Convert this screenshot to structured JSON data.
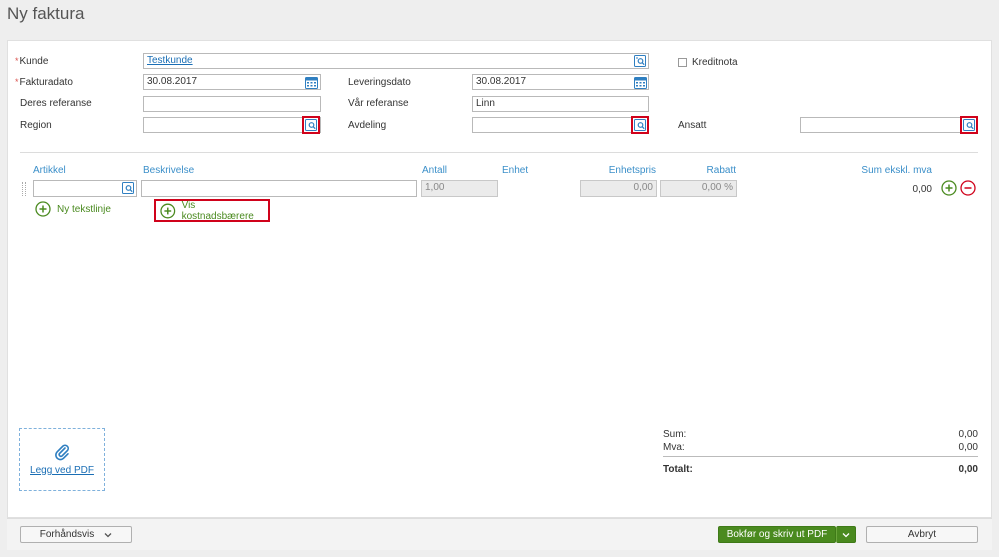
{
  "page": {
    "title": "Ny faktura"
  },
  "header_fields": {
    "kunde": {
      "label": "Kunde",
      "value": "Testkunde"
    },
    "kreditnota": {
      "label": "Kreditnota"
    },
    "fakturadato": {
      "label": "Fakturadato",
      "value": "30.08.2017"
    },
    "leveringsdato": {
      "label": "Leveringsdato",
      "value": "30.08.2017"
    },
    "deres_referanse": {
      "label": "Deres referanse",
      "value": ""
    },
    "var_referanse": {
      "label": "Vår referanse",
      "value": "Linn"
    },
    "region": {
      "label": "Region",
      "value": ""
    },
    "avdeling": {
      "label": "Avdeling",
      "value": ""
    },
    "ansatt": {
      "label": "Ansatt",
      "value": ""
    }
  },
  "lines": {
    "columns": {
      "artikkel": "Artikkel",
      "beskrivelse": "Beskrivelse",
      "antall": "Antall",
      "enhet": "Enhet",
      "enhetspris": "Enhetspris",
      "rabatt": "Rabatt",
      "sum": "Sum ekskl. mva"
    },
    "row": {
      "artikkel": "",
      "beskrivelse": "",
      "antall": "1,00",
      "enhet": "",
      "enhetspris": "0,00",
      "rabatt": "0,00 %",
      "sum": "0,00"
    },
    "add_text_line": "Ny tekstlinje",
    "show_cost_carriers": "Vis kostnadsbærere"
  },
  "attachment": {
    "label": "Legg ved PDF"
  },
  "totals": {
    "sum_label": "Sum:",
    "sum_value": "0,00",
    "mva_label": "Mva:",
    "mva_value": "0,00",
    "total_label": "Totalt:",
    "total_value": "0,00"
  },
  "footer": {
    "preview": "Forhåndsvis",
    "post_print": "Bokfør og skriv ut PDF",
    "cancel": "Avbryt"
  },
  "colors": {
    "accent_blue": "#3b8fc9",
    "green": "#4a8a1f",
    "red": "#d0021b"
  }
}
